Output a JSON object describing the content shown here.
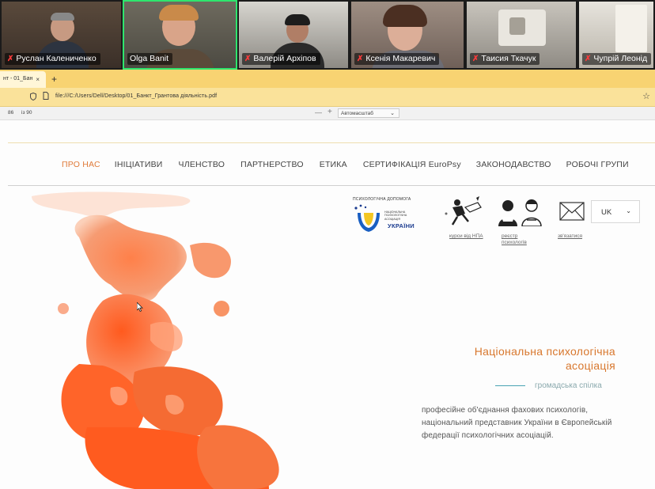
{
  "participants": [
    {
      "name": "Руслан Калениченко",
      "muted": true,
      "active": false
    },
    {
      "name": "Olga Banit",
      "muted": false,
      "active": true
    },
    {
      "name": "Валерій Архіпов",
      "muted": true,
      "active": false
    },
    {
      "name": "Ксенія Макаревич",
      "muted": true,
      "active": false
    },
    {
      "name": "Таисия Ткачук",
      "muted": true,
      "active": false
    },
    {
      "name": "Чупрій Леонід",
      "muted": true,
      "active": false
    }
  ],
  "browser": {
    "tab_title": "нт - 01_Бан",
    "tab_close": "×",
    "new_tab": "+",
    "url": "file:///C:/Users/Dell/Desktop/01_Банкт_Грантова діяльність.pdf"
  },
  "pdf_toolbar": {
    "page": "86",
    "of_pages": "із 90",
    "zoom_minus": "—",
    "zoom_plus": "+",
    "zoom_value": "Автомасштаб"
  },
  "site": {
    "nav": [
      "ПРО НАС",
      "ІНІЦІАТИВИ",
      "ЧЛЕНСТВО",
      "ПАРТНЕРСТВО",
      "ЕТИКА",
      "СЕРТИФІКАЦІЯ EuroPsy",
      "ЗАКОНОДАВСТВО",
      "РОБОЧІ ГРУПИ"
    ],
    "logo": {
      "title": "ПСИХОЛОГІЧНА ДОПОМОГА",
      "small": "НАЦІОНАЛЬНА ПСИХОЛОГІЧНА АСОЦІАЦІЯ",
      "big": "УКРАЇНИ"
    },
    "links": {
      "courses": "курси від НПА",
      "registry": "реєстр психологів",
      "contact": "зв'язатися"
    },
    "language": "UK",
    "hero": {
      "title": "Національна психологічна асоціація",
      "subtitle": "громадська спілка",
      "description": "професійне об'єднання фахових психологів, національний представник України в Європейській федерації психологічних асоціацій."
    }
  },
  "colors": {
    "accent": "#e07b3a",
    "active_speaker": "#2ee56d",
    "tab_bar": "#f8d372",
    "url_bar": "#fae29a"
  }
}
